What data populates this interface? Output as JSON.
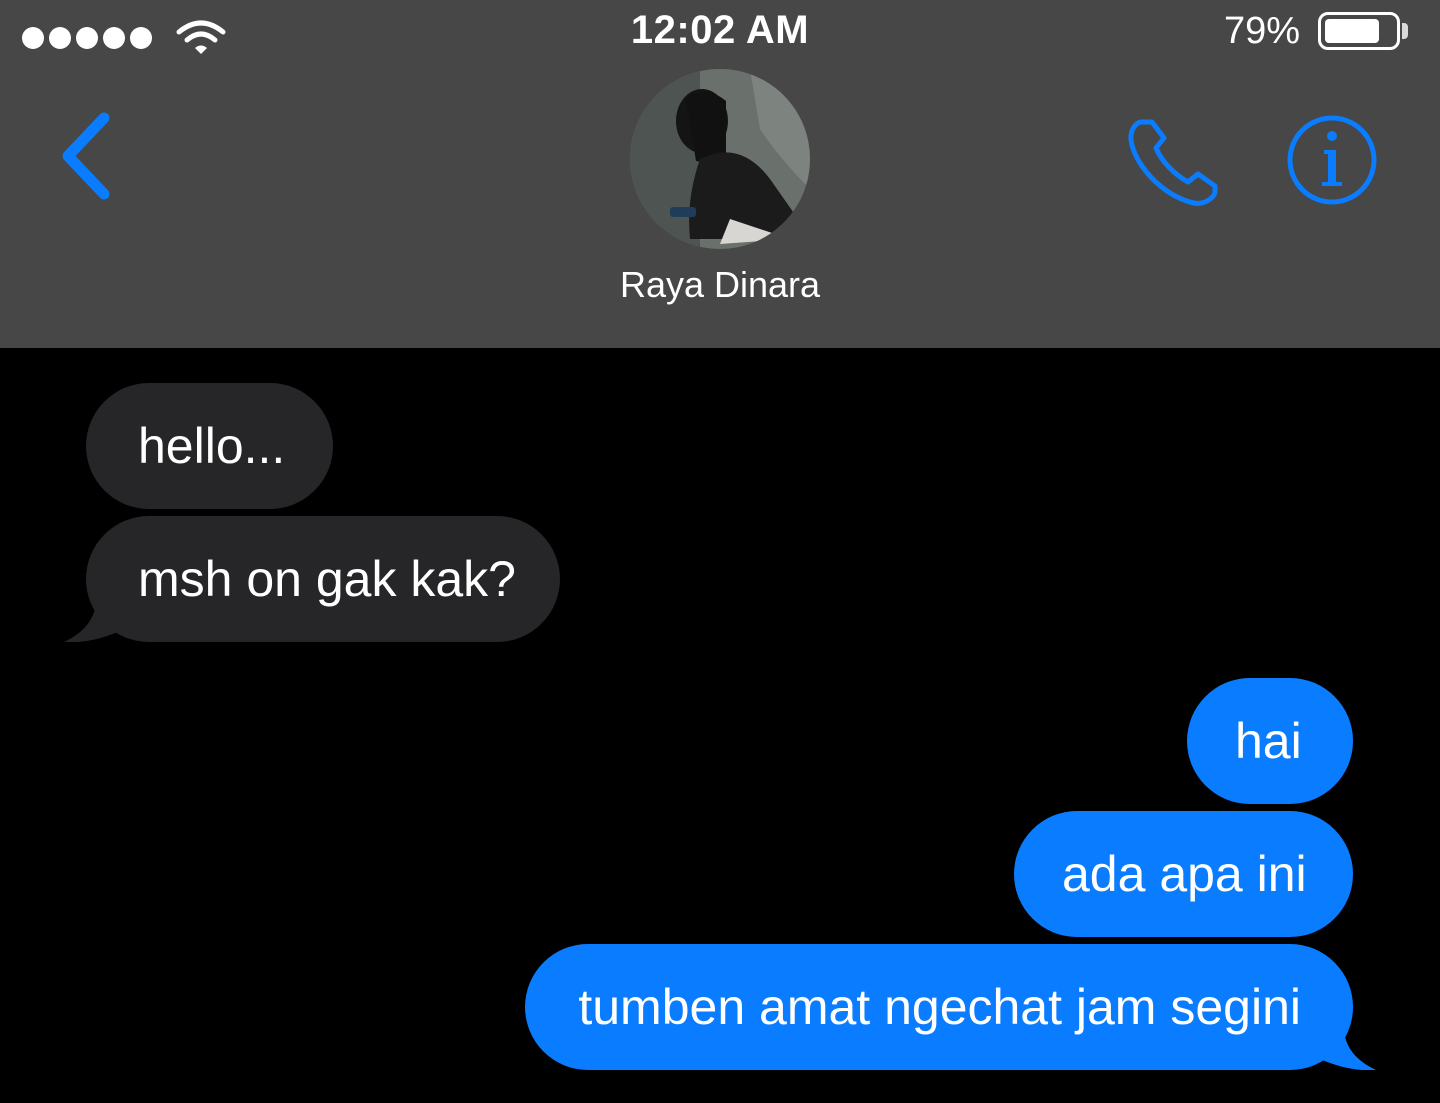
{
  "status_bar": {
    "signal_bars": 5,
    "time": "12:02 AM",
    "battery_percent": "79%",
    "battery_level": 0.79
  },
  "header": {
    "back_icon": "chevron-left-icon",
    "contact_name": "Raya Dinara",
    "call_icon": "phone-icon",
    "info_icon": "info-icon",
    "accent_color": "#0a7cff",
    "header_color": "#474747"
  },
  "messages": [
    {
      "direction": "incoming",
      "text": "hello..."
    },
    {
      "direction": "incoming",
      "text": "msh on gak kak?"
    },
    {
      "direction": "outgoing",
      "text": "hai"
    },
    {
      "direction": "outgoing",
      "text": "ada apa ini"
    },
    {
      "direction": "outgoing",
      "text": "tumben amat ngechat jam segini"
    }
  ],
  "colors": {
    "incoming_bubble": "#262628",
    "outgoing_bubble": "#0a7cff",
    "background": "#000000"
  }
}
